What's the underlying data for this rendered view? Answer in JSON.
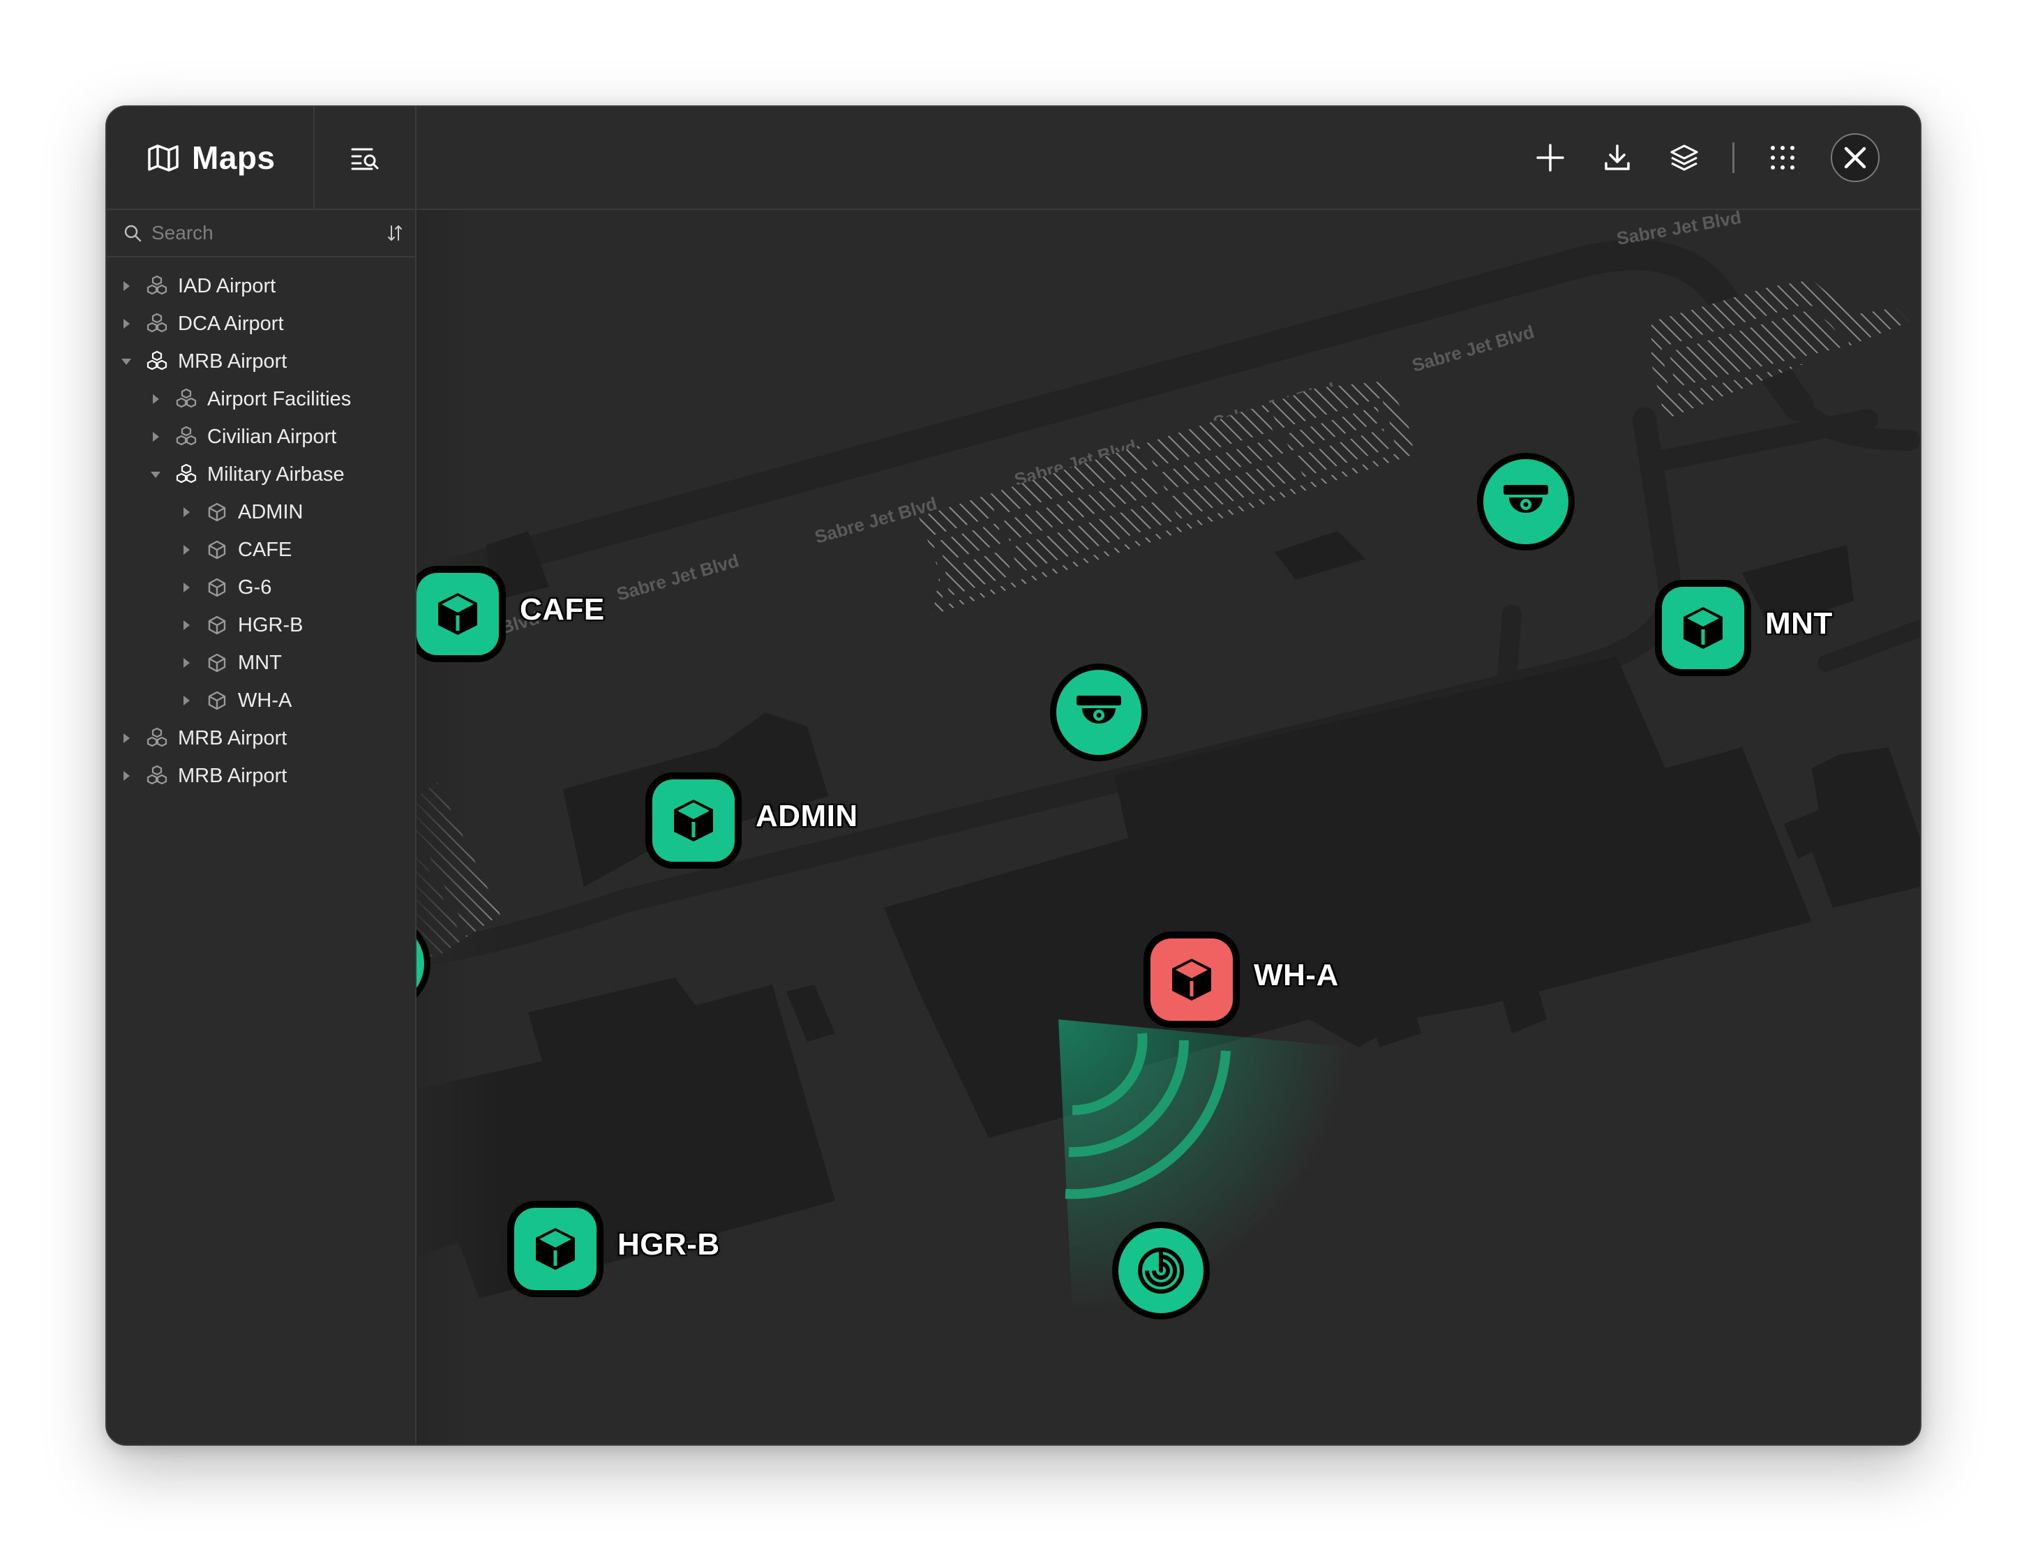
{
  "app": {
    "title": "Maps"
  },
  "search": {
    "placeholder": "Search"
  },
  "toolbar": {
    "buttons": [
      "plus-icon",
      "download-icon",
      "layers-icon",
      "grid-icon",
      "close-icon"
    ]
  },
  "tree": [
    {
      "label": "IAD Airport",
      "level": 0,
      "expanded": false
    },
    {
      "label": "DCA Airport",
      "level": 0,
      "expanded": false
    },
    {
      "label": "MRB Airport",
      "level": 0,
      "expanded": true
    },
    {
      "label": "Airport Facilities",
      "level": 1,
      "expanded": false
    },
    {
      "label": "Civilian Airport",
      "level": 1,
      "expanded": false
    },
    {
      "label": "Military Airbase",
      "level": 1,
      "expanded": true
    },
    {
      "label": "ADMIN",
      "level": 2,
      "expanded": false
    },
    {
      "label": "CAFE",
      "level": 2,
      "expanded": false
    },
    {
      "label": "G-6",
      "level": 2,
      "expanded": false
    },
    {
      "label": "HGR-B",
      "level": 2,
      "expanded": false
    },
    {
      "label": "MNT",
      "level": 2,
      "expanded": false
    },
    {
      "label": "WH-A",
      "level": 2,
      "expanded": false
    },
    {
      "label": "MRB Airport",
      "level": 0,
      "expanded": false
    },
    {
      "label": "MRB Airport",
      "level": 0,
      "expanded": false
    }
  ],
  "map": {
    "road_name": "Sabre Jet Blvd",
    "markers": [
      {
        "label": "CAFE",
        "status": "ok"
      },
      {
        "label": "ADMIN",
        "status": "ok"
      },
      {
        "label": "WH-A",
        "status": "alert"
      },
      {
        "label": "HGR-B",
        "status": "ok"
      },
      {
        "label": "MNT",
        "status": "ok"
      }
    ]
  },
  "colors": {
    "accent_green": "#17c38c",
    "alert_red": "#f06262",
    "window_bg": "#2a2a2a",
    "building": "#1f1f1f"
  }
}
